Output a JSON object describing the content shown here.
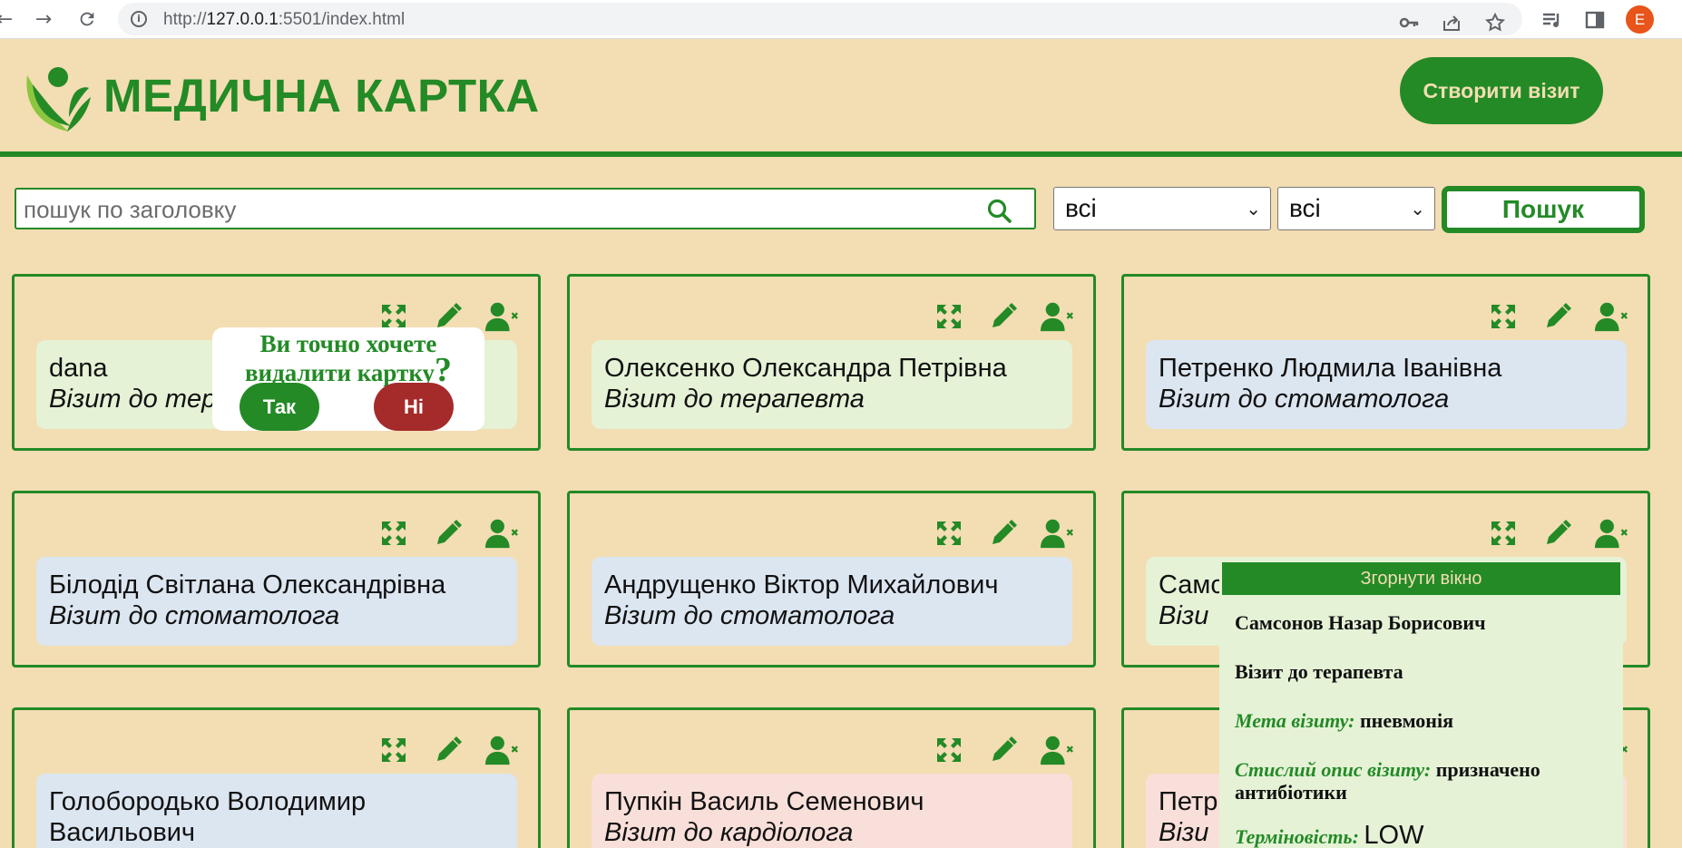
{
  "browser": {
    "url_host": "127.0.0.1",
    "url_scheme": "http://",
    "url_rest": ":5501/index.html",
    "profile_initial": "E"
  },
  "header": {
    "title": "МЕДИЧНА КАРТКА",
    "create_button": "Створити візит"
  },
  "filters": {
    "search_placeholder": "пошук по заголовку",
    "status_select": "всі",
    "urgency_select": "всі",
    "search_button": "Пошук"
  },
  "cards": [
    {
      "name": "dana",
      "doctor": "Візит до терапевта",
      "tone": "green"
    },
    {
      "name": "Олексенко Олександра Петрівна",
      "doctor": "Візит до терапевта",
      "tone": "green"
    },
    {
      "name": "Петренко Людмила Іванівна",
      "doctor": "Візит до стоматолога",
      "tone": "blue"
    },
    {
      "name": "Білодід Світлана Олександрівна",
      "doctor": "Візит до стоматолога",
      "tone": "blue"
    },
    {
      "name": "Андрущенко Віктор Михайлович",
      "doctor": "Візит до стоматолога",
      "tone": "blue"
    },
    {
      "name": "Самс",
      "doctor": "Візи",
      "tone": "green"
    },
    {
      "name": "Голобородько Володимир Васильович",
      "doctor": "",
      "tone": "blue"
    },
    {
      "name": "Пупкін Василь Семенович",
      "doctor": "Візит до кардіолога",
      "tone": "pink"
    },
    {
      "name": "Петр",
      "doctor": "Візи",
      "tone": "pink"
    }
  ],
  "confirm": {
    "text_line1": "Ви точно хочете",
    "text_line2": "видалити картку",
    "question_mark": "?",
    "yes": "Так",
    "no": "Ні"
  },
  "details": {
    "collapse_button": "Згорнути вікно",
    "name": "Самсонов Назар Борисович",
    "doctor": "Візит до терапевта",
    "purpose_label": "Мета візиту:",
    "purpose_value": "пневмонія",
    "description_label": "Стислий опис візиту:",
    "description_value": "призначено антибіотики",
    "urgency_label": "Терміновість:",
    "urgency_value": "LOW"
  },
  "colors": {
    "brand_green": "#238a26",
    "background": "#f3ddb3",
    "danger": "#a52a2a"
  }
}
